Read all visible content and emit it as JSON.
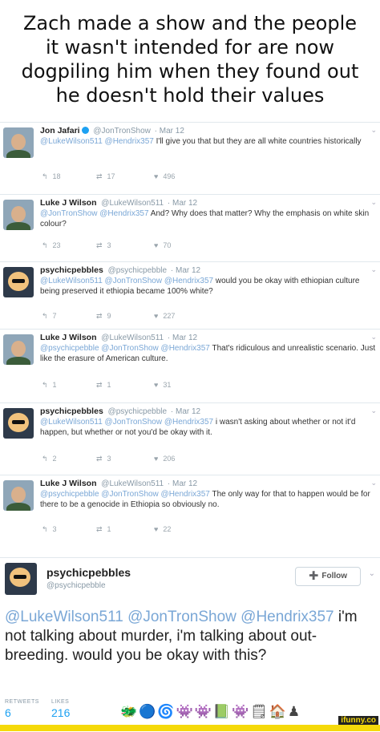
{
  "caption": [
    "Zach made a show and the people",
    "it wasn't intended for are now",
    "dogpiling him when they found out",
    "he doesn't hold their values"
  ],
  "tweets": [
    {
      "name": "Jon Jafari",
      "handle": "@JonTronShow",
      "date": "· Mar 12",
      "mentions": "@LukeWilson511 @Hendrix357",
      "text": " I'll give you that but they are all white countries historically",
      "replies": "18",
      "retweets": "17",
      "likes": "496"
    },
    {
      "name": "Luke J Wilson",
      "handle": "@LukeWilson511",
      "date": "· Mar 12",
      "mentions": "@JonTronShow @Hendrix357",
      "text": " And? Why does that matter? Why the emphasis on white skin colour?",
      "replies": "23",
      "retweets": "3",
      "likes": "70"
    },
    {
      "name": "psychicpebbles",
      "handle": "@psychicpebble",
      "date": "· Mar 12",
      "mentions": "@LukeWilson511 @JonTronShow @Hendrix357",
      "text": " would you be okay with ethiopian culture being preserved it ethiopia became 100% white?",
      "replies": "7",
      "retweets": "9",
      "likes": "227"
    },
    {
      "name": "Luke J Wilson",
      "handle": "@LukeWilson511",
      "date": "· Mar 12",
      "mentions": "@psychicpebble @JonTronShow @Hendrix357",
      "text": " That's ridiculous and unrealistic scenario. Just like the erasure of American culture.",
      "replies": "1",
      "retweets": "1",
      "likes": "31"
    },
    {
      "name": "psychicpebbles",
      "handle": "@psychicpebble",
      "date": "· Mar 12",
      "mentions": "@LukeWilson511 @JonTronShow @Hendrix357",
      "text": " i wasn't asking about whether or not it'd happen, but whether or not you'd be okay with it.",
      "replies": "2",
      "retweets": "3",
      "likes": "206"
    },
    {
      "name": "Luke J Wilson",
      "handle": "@LukeWilson511",
      "date": "· Mar 12",
      "mentions": "@psychicpebble @JonTronShow @Hendrix357",
      "text": " The only way for that to happen would be for there to be a genocide in Ethiopia so obviously no.",
      "replies": "3",
      "retweets": "1",
      "likes": "22"
    }
  ],
  "main_tweet": {
    "name": "psychicpebbles",
    "handle": "@psychicpebble",
    "follow_label": "Follow",
    "mentions": "@LukeWilson511 @JonTronShow @Hendrix357",
    "text": " i'm not talking about murder, i'm talking about out-breeding. would you be okay with this?",
    "retweets_label": "RETWEETS",
    "retweets_value": "6",
    "likes_label": "LIKES",
    "likes_value": "216",
    "liker_avatars": "🐲🔵🌀👾👾📗👾🗒🏠♟"
  },
  "icons": {
    "reply": "↰",
    "retweet": "⇄",
    "like": "♥",
    "follow": "➕",
    "caret": "⌄"
  },
  "watermark": "ifunny.co",
  "colors": {
    "mention": "#7aa7d6",
    "accent": "#1da1f2",
    "watermark_bar": "#f5d90a"
  }
}
